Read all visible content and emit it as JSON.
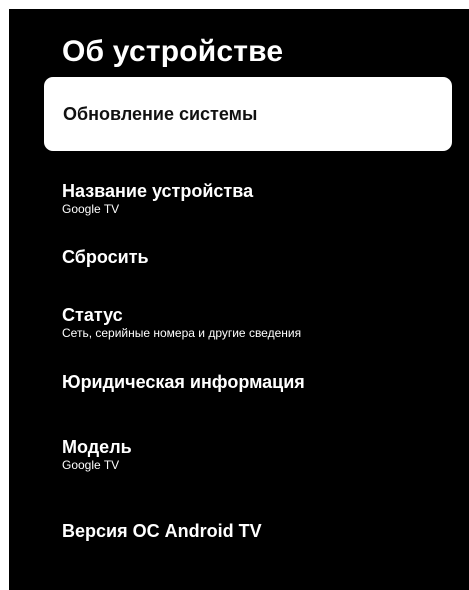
{
  "page": {
    "title": "Об устройстве"
  },
  "menu": {
    "items": [
      {
        "label": "Обновление системы",
        "selected": true
      },
      {
        "label": "Название устройства",
        "sublabel": "Google TV"
      },
      {
        "label": "Сбросить"
      },
      {
        "label": "Статус",
        "sublabel": "Сеть, серийные номера и другие сведения"
      },
      {
        "label": "Юридическая информация"
      },
      {
        "label": "Модель",
        "sublabel": "Google TV"
      },
      {
        "label": "Версия ОС Android TV"
      }
    ]
  },
  "colors": {
    "background": "#000000",
    "text": "#ffffff",
    "selected_background": "#ffffff",
    "selected_text": "#111111"
  }
}
